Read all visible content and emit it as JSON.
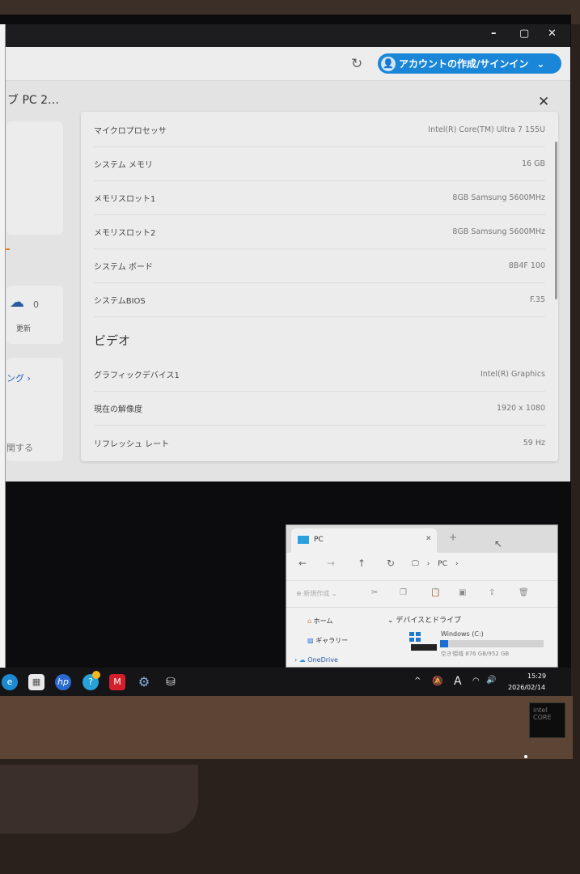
{
  "window": {
    "minimize": "–",
    "maximize": "▢",
    "close": "✕"
  },
  "header": {
    "refresh_icon": "refresh-icon",
    "account_label": "アカウントの作成/サインイン",
    "account_chevron": "⌄"
  },
  "breadcrumb": "ブ PC 2…",
  "left_cards": {
    "updates_count": "0",
    "updates_label": "更新",
    "link_label": "ング ›",
    "bottom_label": "関する"
  },
  "dialog": {
    "close": "✕",
    "rows_top": [
      {
        "label": "マイクロプロセッサ",
        "value": "Intel(R) Core(TM) Ultra 7 155U"
      },
      {
        "label": "システム メモリ",
        "value": "16 GB"
      },
      {
        "label": "メモリスロット1",
        "value": "8GB Samsung 5600MHz"
      },
      {
        "label": "メモリスロット2",
        "value": "8GB Samsung 5600MHz"
      },
      {
        "label": "システム ボード",
        "value": "8B4F 100"
      },
      {
        "label": "システムBIOS",
        "value": "F.35"
      }
    ],
    "section_video": "ビデオ",
    "rows_video": [
      {
        "label": "グラフィックデバイス1",
        "value": "Intel(R) Graphics"
      },
      {
        "label": "現在の解像度",
        "value": "1920 x 1080"
      },
      {
        "label": "リフレッシュ レート",
        "value": "59 Hz"
      }
    ]
  },
  "explorer": {
    "tab_title": "PC",
    "tab_close": "✕",
    "new_tab": "+",
    "path": "PC",
    "new_button": "新規作成",
    "nav": [
      "ホーム",
      "ギャラリー",
      "OneDrive"
    ],
    "section": "デバイスとドライブ",
    "drive_name": "Windows (C:)",
    "drive_free": "空き領域 876 GB/952 GB",
    "drive_used_fraction": 0.08
  },
  "taskbar": {
    "time": "15:29",
    "date": "2026/02/14",
    "ime": "A"
  },
  "bezel": {
    "badge": "intel CORE"
  }
}
